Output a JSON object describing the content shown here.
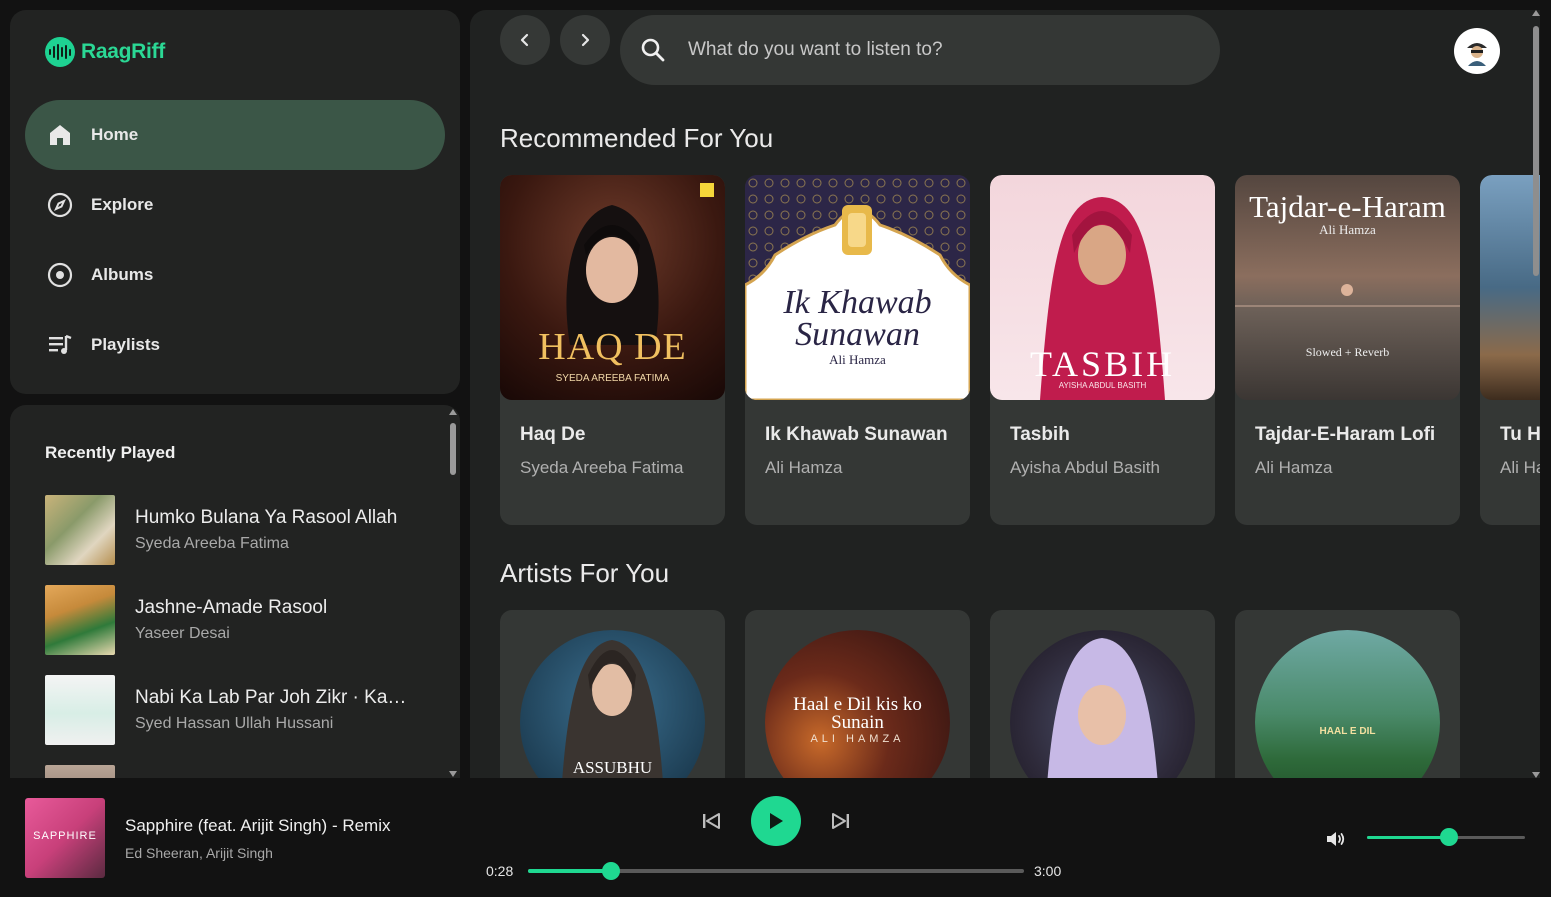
{
  "app": {
    "name": "RaagRiff",
    "brand_color": "#1fd891"
  },
  "nav": {
    "items": [
      {
        "label": "Home",
        "icon": "home-icon",
        "active": true
      },
      {
        "label": "Explore",
        "icon": "compass-icon",
        "active": false
      },
      {
        "label": "Albums",
        "icon": "disc-icon",
        "active": false
      },
      {
        "label": "Playlists",
        "icon": "playlist-icon",
        "active": false
      }
    ]
  },
  "recently_played": {
    "title": "Recently Played",
    "items": [
      {
        "name": "Humko Bulana Ya Rasool Allah",
        "artist": "Syeda Areeba Fatima"
      },
      {
        "name": "Jashne-Amade Rasool",
        "artist": "Yaseer Desai"
      },
      {
        "name": "Nabi Ka Lab Par Joh Zikr · Kamal Aya",
        "artist": "Syed Hassan Ullah Hussani"
      }
    ]
  },
  "search": {
    "placeholder": "What do you want to listen to?"
  },
  "recommended": {
    "title": "Recommended For You",
    "cards": [
      {
        "title": "Haq De",
        "artist": "Syeda Areeba Fatima",
        "art_text": "HAQ DE",
        "art_sub": "SYEDA AREEBA FATIMA"
      },
      {
        "title": "Ik Khawab Sunawan",
        "artist": "Ali Hamza",
        "art_text": "Ik Khawab Sunawan",
        "art_sub": "Ali Hamza"
      },
      {
        "title": "Tasbih",
        "artist": "Ayisha Abdul Basith",
        "art_text": "TASBIH",
        "art_sub": "AYISHA ABDUL BASITH"
      },
      {
        "title": "Tajdar-E-Haram Lofi",
        "artist": "Ali Hamza",
        "art_text": "Tajdar-e-Haram",
        "art_sub": "Ali Hamza",
        "art_tag": "Slowed + Reverb"
      },
      {
        "title": "Tu Hi",
        "artist": "Ali Hamza"
      }
    ]
  },
  "artists": {
    "title": "Artists For You",
    "cards": [
      {
        "art_text": "ASSUBHU"
      },
      {
        "art_text": "Haal e Dil kis ko Sunain",
        "art_sub": "ALI HAMZA"
      },
      {
        "art_text": ""
      },
      {
        "art_text": "HAAL E DIL"
      }
    ]
  },
  "player": {
    "title": "Sapphire (feat. Arijit Singh) - Remix",
    "artist": "Ed Sheeran, Arijit Singh",
    "cover_text": "SAPPHIRE",
    "elapsed": "0:28",
    "duration": "3:00",
    "progress": 0.167,
    "volume": 0.52
  }
}
